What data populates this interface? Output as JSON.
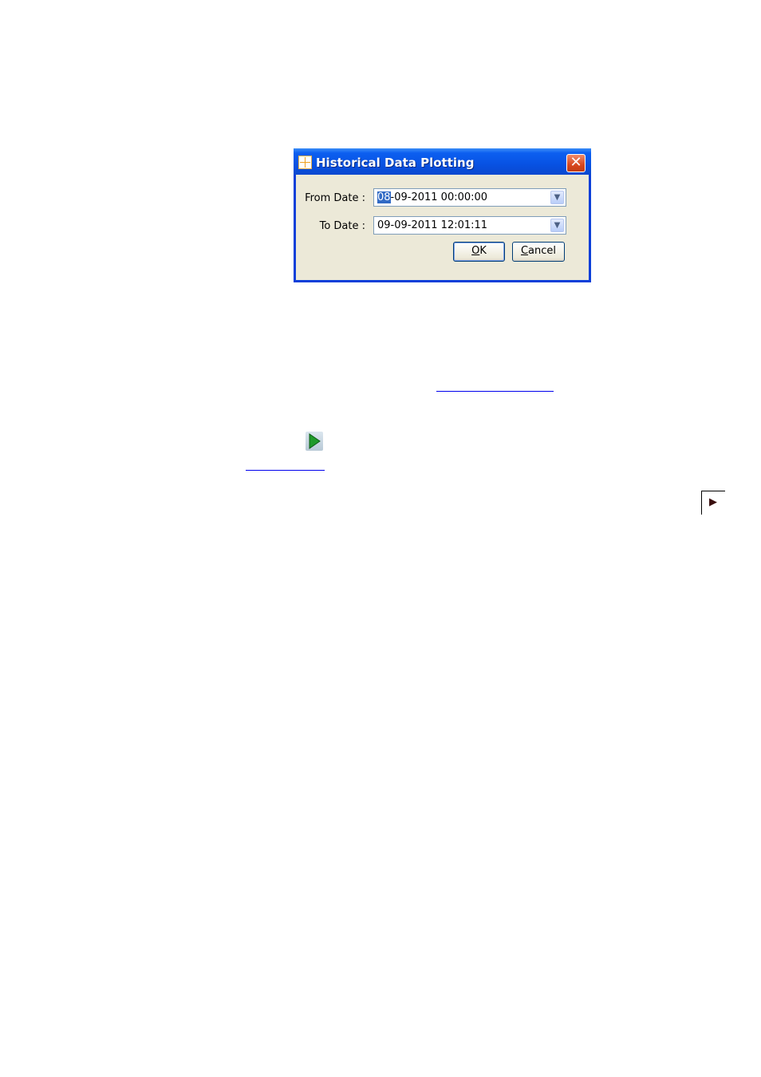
{
  "dialog": {
    "title": "Historical Data Plotting",
    "close_symbol": "✕",
    "from_label": "From Date :",
    "from_value_selected": "08",
    "from_value_rest": "-09-2011 00:00:00",
    "to_label": "To Date :",
    "to_value": "09-09-2011 12:01:11",
    "ok_accel": "O",
    "ok_rest": "K",
    "cancel_accel": "C",
    "cancel_rest": "ancel",
    "dropdown_symbol": "▼"
  },
  "document": {
    "corner_marker": "▶"
  }
}
